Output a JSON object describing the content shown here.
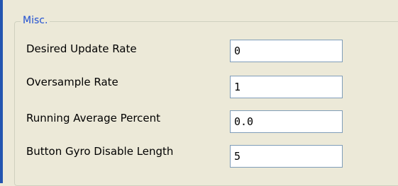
{
  "group": {
    "title": "Misc."
  },
  "fields": [
    {
      "label": "Desired Update Rate",
      "value": "0"
    },
    {
      "label": "Oversample Rate",
      "value": "1"
    },
    {
      "label": "Running Average Percent",
      "value": "0.0"
    },
    {
      "label": "Button Gyro Disable Length",
      "value": "5"
    }
  ],
  "colors": {
    "group_title": "#1f4fd1",
    "left_bar": "#2455b0",
    "background": "#ece9d8",
    "input_border": "#7f9db9"
  }
}
